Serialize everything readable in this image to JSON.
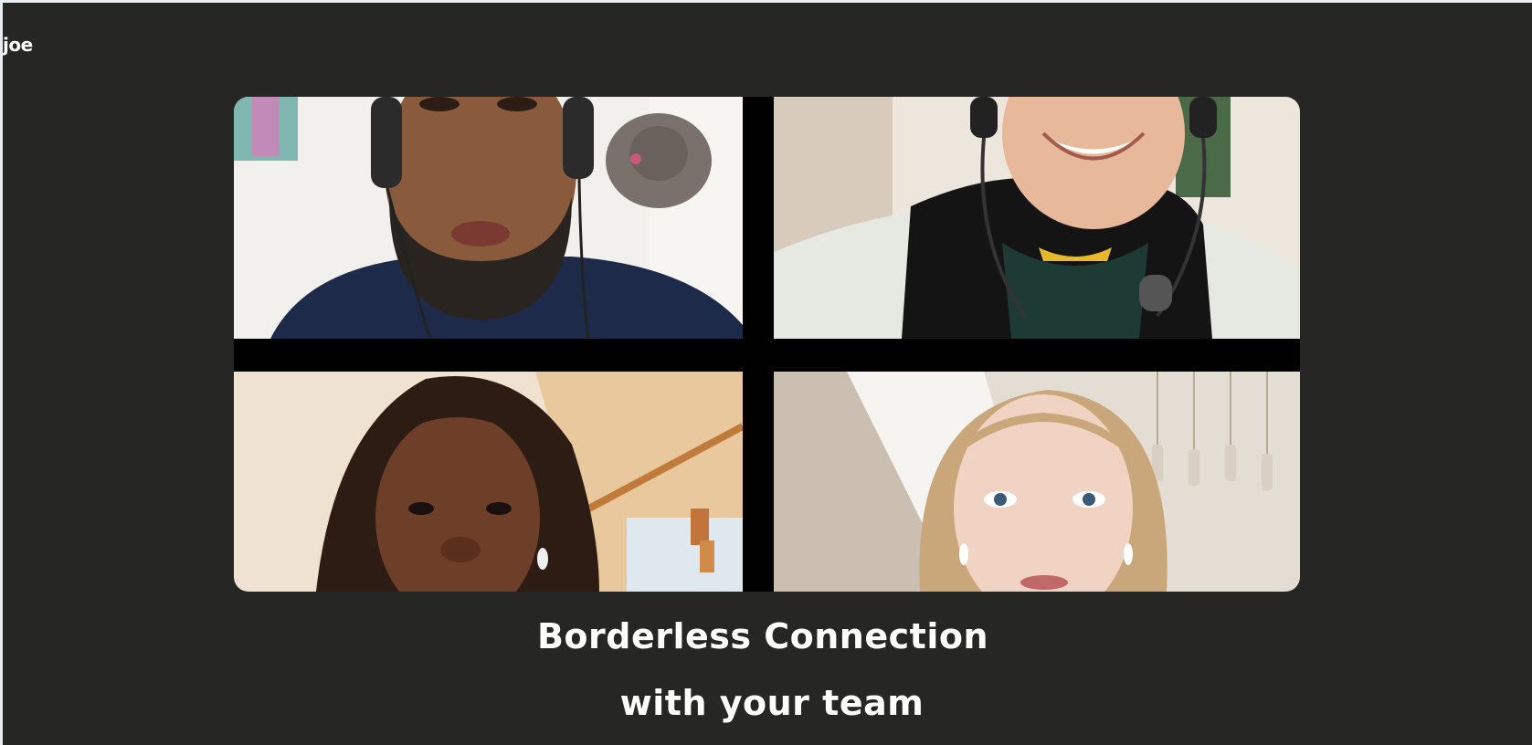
{
  "user": {
    "name": "joe"
  },
  "hero": {
    "participants": [
      {
        "icon": "participant-video-1"
      },
      {
        "icon": "participant-video-2"
      },
      {
        "icon": "participant-video-3"
      },
      {
        "icon": "participant-video-4"
      }
    ]
  },
  "headline": {
    "line1": "Borderless Connection",
    "line2": "with your team"
  },
  "colors": {
    "background": "#262624",
    "text": "#ffffff",
    "grid_gap": "#000000"
  }
}
